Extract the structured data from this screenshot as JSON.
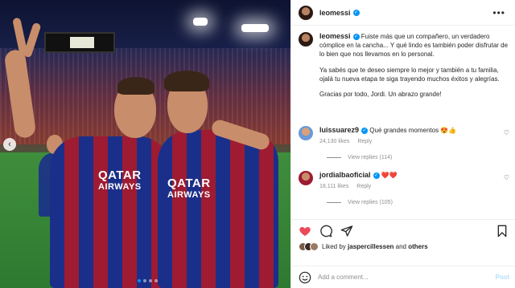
{
  "post": {
    "author": "leomessi",
    "caption_paragraphs": [
      "Fuiste más que un compañero, un verdadero cómplice en la cancha... Y qué lindo es también poder disfrutar de lo bien que nos llevamos en lo personal.",
      "Ya sabés que te deseo siempre lo mejor y también a tu familia, ojalá tu nueva etapa te siga trayendo muchos éxitos y alegrías.",
      "Gracias por todo, Jordi. Un abrazo grande!"
    ],
    "photo": {
      "sponsor_left": "QATAR",
      "sponsor_left_sub": "AIRWAYS",
      "sponsor_right": "QATAR",
      "sponsor_right_sub": "AIRWAYS",
      "prev_arrow": "‹",
      "carousel_count": 4,
      "carousel_active_index": 0
    }
  },
  "header": {
    "username": "leomessi",
    "menu_glyph": "•••"
  },
  "comments": [
    {
      "username": "luissuarez9",
      "text": "Qué grandes momentos 😍👍",
      "likes": "24,130 likes",
      "reply_label": "Reply",
      "view_replies": "View replies (114)"
    },
    {
      "username": "jordialbaoficial",
      "text": "❤️❤️",
      "likes": "18,111 likes",
      "reply_label": "Reply",
      "view_replies": "View replies (105)"
    }
  ],
  "likes": {
    "prefix": "Liked by ",
    "first_user": "jaspercillessen",
    "middle": " and ",
    "others": "others"
  },
  "add_comment": {
    "placeholder": "Add a comment...",
    "post_label": "Post"
  },
  "icons": {
    "like": "heart-icon",
    "comment": "comment-icon",
    "share": "share-icon",
    "save": "bookmark-icon",
    "emoji": "emoji-icon"
  },
  "colors": {
    "accent": "#0095f6",
    "like_red": "#ed4956",
    "post_disabled": "#b2dffc"
  }
}
